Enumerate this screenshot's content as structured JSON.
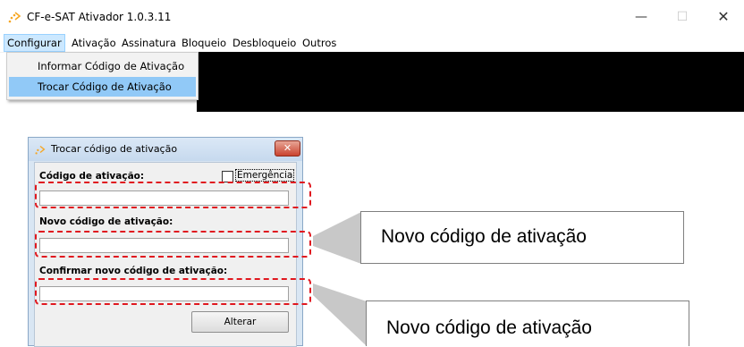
{
  "window": {
    "title": "CF-e-SAT Ativador 1.0.3.11",
    "minimize_glyph": "—",
    "maximize_glyph": "☐",
    "close_glyph": "✕",
    "icon": "sparkle-arrow-icon"
  },
  "menu": {
    "items": [
      "Configurar",
      "Ativação",
      "Assinatura",
      "Bloqueio",
      "Desbloqueio",
      "Outros"
    ],
    "open_menu": "Configurar",
    "dropdown": [
      "Informar Código de Ativação",
      "Trocar Código de Ativação"
    ],
    "highlighted_index": 1
  },
  "dialog": {
    "title": "Trocar código de ativação",
    "close_glyph": "✕",
    "fields": {
      "codigo_label": "Código de ativação:",
      "codigo_value": "",
      "emergencia_label": "Emergência",
      "emergencia_checked": false,
      "novo_label": "Novo código de ativação:",
      "novo_value": "",
      "confirmar_label": "Confirmar novo código de ativação:",
      "confirmar_value": ""
    },
    "button_label": "Alterar"
  },
  "callouts": [
    {
      "text": "Novo código de ativação"
    },
    {
      "text": "Novo código de ativação"
    }
  ],
  "colors": {
    "highlight": "#e0181f",
    "menu_selected": "#91c9f7",
    "dialog_frame": "#d9e6f3",
    "callout_shadow": "#c8c8c8"
  }
}
